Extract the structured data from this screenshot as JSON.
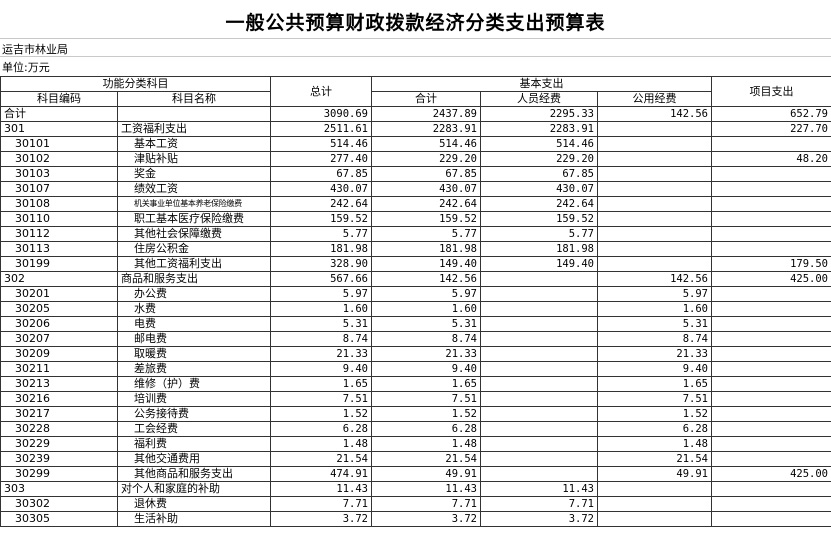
{
  "title": "一般公共预算财政拨款经济分类支出预算表",
  "org_label": "运吉市林业局",
  "unit_label": "单位:万元",
  "headers": {
    "functional_category": "功能分类科目",
    "code": "科目编码",
    "name": "科目名称",
    "total": "总计",
    "basic": "基本支出",
    "subtotal": "合计",
    "personnel": "人员经费",
    "public": "公用经费",
    "project": "项目支出"
  },
  "rows": [
    {
      "code": "合计",
      "name": "",
      "total": "3090.69",
      "subtotal": "2437.89",
      "personnel": "2295.33",
      "public": "142.56",
      "project": "652.79",
      "level": 0
    },
    {
      "code": "301",
      "name": "工资福利支出",
      "total": "2511.61",
      "subtotal": "2283.91",
      "personnel": "2283.91",
      "public": "",
      "project": "227.70",
      "level": 1
    },
    {
      "code": "30101",
      "name": "基本工资",
      "total": "514.46",
      "subtotal": "514.46",
      "personnel": "514.46",
      "public": "",
      "project": "",
      "level": 2
    },
    {
      "code": "30102",
      "name": "津贴补贴",
      "total": "277.40",
      "subtotal": "229.20",
      "personnel": "229.20",
      "public": "",
      "project": "48.20",
      "level": 2
    },
    {
      "code": "30103",
      "name": "奖金",
      "total": "67.85",
      "subtotal": "67.85",
      "personnel": "67.85",
      "public": "",
      "project": "",
      "level": 2
    },
    {
      "code": "30107",
      "name": "绩效工资",
      "total": "430.07",
      "subtotal": "430.07",
      "personnel": "430.07",
      "public": "",
      "project": "",
      "level": 2
    },
    {
      "code": "30108",
      "name": "机关事业单位基本养老保险缴费",
      "total": "242.64",
      "subtotal": "242.64",
      "personnel": "242.64",
      "public": "",
      "project": "",
      "level": 2,
      "tiny": true
    },
    {
      "code": "30110",
      "name": "职工基本医疗保险缴费",
      "total": "159.52",
      "subtotal": "159.52",
      "personnel": "159.52",
      "public": "",
      "project": "",
      "level": 2
    },
    {
      "code": "30112",
      "name": "其他社会保障缴费",
      "total": "5.77",
      "subtotal": "5.77",
      "personnel": "5.77",
      "public": "",
      "project": "",
      "level": 2
    },
    {
      "code": "30113",
      "name": "住房公积金",
      "total": "181.98",
      "subtotal": "181.98",
      "personnel": "181.98",
      "public": "",
      "project": "",
      "level": 2
    },
    {
      "code": "30199",
      "name": "其他工资福利支出",
      "total": "328.90",
      "subtotal": "149.40",
      "personnel": "149.40",
      "public": "",
      "project": "179.50",
      "level": 2
    },
    {
      "code": "302",
      "name": "商品和服务支出",
      "total": "567.66",
      "subtotal": "142.56",
      "personnel": "",
      "public": "142.56",
      "project": "425.00",
      "level": 1
    },
    {
      "code": "30201",
      "name": "办公费",
      "total": "5.97",
      "subtotal": "5.97",
      "personnel": "",
      "public": "5.97",
      "project": "",
      "level": 2
    },
    {
      "code": "30205",
      "name": "水费",
      "total": "1.60",
      "subtotal": "1.60",
      "personnel": "",
      "public": "1.60",
      "project": "",
      "level": 2
    },
    {
      "code": "30206",
      "name": "电费",
      "total": "5.31",
      "subtotal": "5.31",
      "personnel": "",
      "public": "5.31",
      "project": "",
      "level": 2
    },
    {
      "code": "30207",
      "name": "邮电费",
      "total": "8.74",
      "subtotal": "8.74",
      "personnel": "",
      "public": "8.74",
      "project": "",
      "level": 2
    },
    {
      "code": "30209",
      "name": "取暖费",
      "total": "21.33",
      "subtotal": "21.33",
      "personnel": "",
      "public": "21.33",
      "project": "",
      "level": 2
    },
    {
      "code": "30211",
      "name": "差旅费",
      "total": "9.40",
      "subtotal": "9.40",
      "personnel": "",
      "public": "9.40",
      "project": "",
      "level": 2
    },
    {
      "code": "30213",
      "name": "维修（护）费",
      "total": "1.65",
      "subtotal": "1.65",
      "personnel": "",
      "public": "1.65",
      "project": "",
      "level": 2
    },
    {
      "code": "30216",
      "name": "培训费",
      "total": "7.51",
      "subtotal": "7.51",
      "personnel": "",
      "public": "7.51",
      "project": "",
      "level": 2
    },
    {
      "code": "30217",
      "name": "公务接待费",
      "total": "1.52",
      "subtotal": "1.52",
      "personnel": "",
      "public": "1.52",
      "project": "",
      "level": 2
    },
    {
      "code": "30228",
      "name": "工会经费",
      "total": "6.28",
      "subtotal": "6.28",
      "personnel": "",
      "public": "6.28",
      "project": "",
      "level": 2
    },
    {
      "code": "30229",
      "name": "福利费",
      "total": "1.48",
      "subtotal": "1.48",
      "personnel": "",
      "public": "1.48",
      "project": "",
      "level": 2
    },
    {
      "code": "30239",
      "name": "其他交通费用",
      "total": "21.54",
      "subtotal": "21.54",
      "personnel": "",
      "public": "21.54",
      "project": "",
      "level": 2
    },
    {
      "code": "30299",
      "name": "其他商品和服务支出",
      "total": "474.91",
      "subtotal": "49.91",
      "personnel": "",
      "public": "49.91",
      "project": "425.00",
      "level": 2
    },
    {
      "code": "303",
      "name": "对个人和家庭的补助",
      "total": "11.43",
      "subtotal": "11.43",
      "personnel": "11.43",
      "public": "",
      "project": "",
      "level": 1
    },
    {
      "code": "30302",
      "name": "退休费",
      "total": "7.71",
      "subtotal": "7.71",
      "personnel": "7.71",
      "public": "",
      "project": "",
      "level": 2
    },
    {
      "code": "30305",
      "name": "生活补助",
      "total": "3.72",
      "subtotal": "3.72",
      "personnel": "3.72",
      "public": "",
      "project": "",
      "level": 2
    }
  ]
}
